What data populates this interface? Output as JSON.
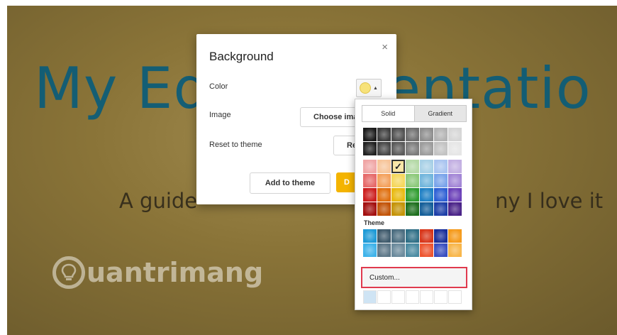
{
  "slide": {
    "title": "My Ed",
    "title_tail": "sentatio",
    "subtitle_left": "A guide",
    "subtitle_right": "ny I love it"
  },
  "watermark": {
    "text": "uantrimang"
  },
  "dialog": {
    "title": "Background",
    "close": "×",
    "color_label": "Color",
    "image_label": "Image",
    "reset_label": "Reset to theme",
    "choose_image_button": "Choose ima",
    "reset_button": "Re",
    "add_to_theme_button": "Add to theme",
    "done_button": "D"
  },
  "picker": {
    "tabs": [
      "Solid",
      "Gradient"
    ],
    "theme_label": "Theme",
    "custom_label": "Custom...",
    "check": "✓",
    "gray_rows": [
      [
        "#1a1a1a",
        "#3d3d3d",
        "#4f4f4f",
        "#6e6e6e",
        "#8e8e8e",
        "#b3b3b3",
        "#d6d6d6"
      ],
      [
        "#222222",
        "#464646",
        "#5a5a5a",
        "#7a7a7a",
        "#9c9c9c",
        "#c2c2c2",
        "#e6e6e6"
      ]
    ],
    "color_rows": [
      [
        "#f0a6a6",
        "#f7c59a",
        "#f8e29a",
        "#b4d9a6",
        "#a7d0e6",
        "#a9c4f0",
        "#c3b0e2"
      ],
      [
        "#e66a6a",
        "#f4a15c",
        "#f5d75c",
        "#8cc97a",
        "#72b6dc",
        "#7aa4ea",
        "#a386d6"
      ],
      [
        "#cc1e1e",
        "#e0700f",
        "#e8b90f",
        "#2f9c2f",
        "#1f80c4",
        "#2d5fd4",
        "#6a3fb8"
      ],
      [
        "#a30f0f",
        "#c25205",
        "#c49306",
        "#1d6f1d",
        "#155f99",
        "#1d3fa8",
        "#4a2388"
      ]
    ],
    "theme_rows": [
      [
        "#1e9ad6",
        "#3f5a6c",
        "#4b6d80",
        "#2f6f86",
        "#d8361a",
        "#1a2f9a",
        "#f59a1a"
      ],
      [
        "#3fb3ea",
        "#5d7788",
        "#6b8a9c",
        "#4b8ba2",
        "#ee5530",
        "#3a4fc0",
        "#f8b64a"
      ]
    ],
    "custom_row": [
      "#cfe4f4",
      "#ffffff",
      "#ffffff",
      "#ffffff",
      "#ffffff",
      "#ffffff",
      "#ffffff"
    ],
    "selected": {
      "row": 0,
      "col": 2
    }
  }
}
